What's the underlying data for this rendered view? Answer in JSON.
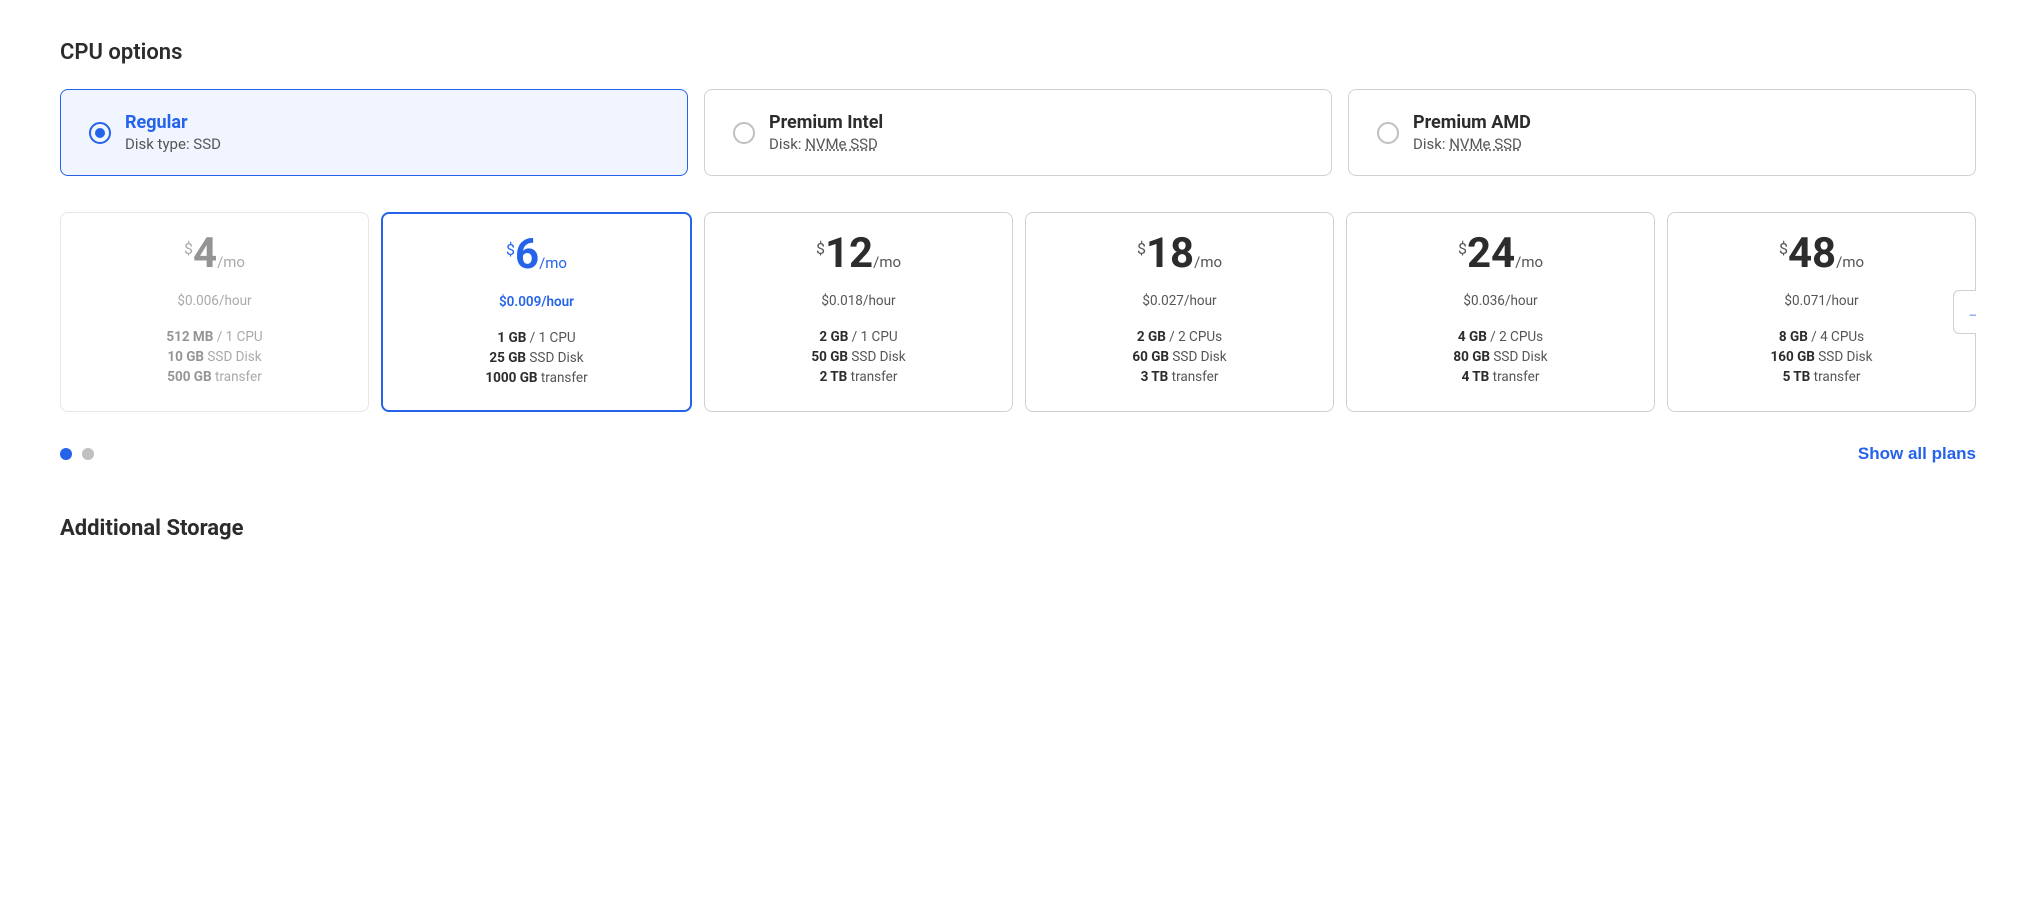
{
  "page": {
    "section_title": "CPU options",
    "additional_storage_title": "Additional Storage"
  },
  "cpu_options": [
    {
      "id": "regular",
      "name": "Regular",
      "disk": "Disk type: SSD",
      "selected": true
    },
    {
      "id": "premium-intel",
      "name": "Premium Intel",
      "disk": "Disk: NVMe SSD",
      "selected": false
    },
    {
      "id": "premium-amd",
      "name": "Premium AMD",
      "disk": "Disk: NVMe SSD",
      "selected": false
    }
  ],
  "plans": [
    {
      "id": "plan-4",
      "price": "4",
      "per_mo": "/mo",
      "hourly": "$0.006/hour",
      "ram": "512 MB",
      "cpu": "1 CPU",
      "disk_size": "10 GB",
      "disk_type": "SSD Disk",
      "transfer": "500 GB",
      "transfer_unit": "transfer",
      "selected": false,
      "dimmed": true
    },
    {
      "id": "plan-6",
      "price": "6",
      "per_mo": "/mo",
      "hourly": "$0.009/hour",
      "ram": "1 GB",
      "cpu": "1 CPU",
      "disk_size": "25 GB",
      "disk_type": "SSD Disk",
      "transfer": "1000 GB",
      "transfer_unit": "transfer",
      "selected": true,
      "dimmed": false
    },
    {
      "id": "plan-12",
      "price": "12",
      "per_mo": "/mo",
      "hourly": "$0.018/hour",
      "ram": "2 GB",
      "cpu": "1 CPU",
      "disk_size": "50 GB",
      "disk_type": "SSD Disk",
      "transfer": "2 TB",
      "transfer_unit": "transfer",
      "selected": false,
      "dimmed": false
    },
    {
      "id": "plan-18",
      "price": "18",
      "per_mo": "/mo",
      "hourly": "$0.027/hour",
      "ram": "2 GB",
      "cpu": "2 CPUs",
      "disk_size": "60 GB",
      "disk_type": "SSD Disk",
      "transfer": "3 TB",
      "transfer_unit": "transfer",
      "selected": false,
      "dimmed": false
    },
    {
      "id": "plan-24",
      "price": "24",
      "per_mo": "/mo",
      "hourly": "$0.036/hour",
      "ram": "4 GB",
      "cpu": "2 CPUs",
      "disk_size": "80 GB",
      "disk_type": "SSD Disk",
      "transfer": "4 TB",
      "transfer_unit": "transfer",
      "selected": false,
      "dimmed": false
    },
    {
      "id": "plan-48",
      "price": "48",
      "per_mo": "/mo",
      "hourly": "$0.071/hour",
      "ram": "8 GB",
      "cpu": "4 CPUs",
      "disk_size": "160 GB",
      "disk_type": "SSD Disk",
      "transfer": "5 TB",
      "transfer_unit": "transfer",
      "selected": false,
      "dimmed": false
    }
  ],
  "pagination": {
    "dots": [
      true,
      false
    ],
    "show_all_label": "Show all plans"
  },
  "colors": {
    "accent": "#2563eb",
    "border_default": "#d0d0d0",
    "text_muted": "#888",
    "text_dark": "#2c2c2c"
  }
}
